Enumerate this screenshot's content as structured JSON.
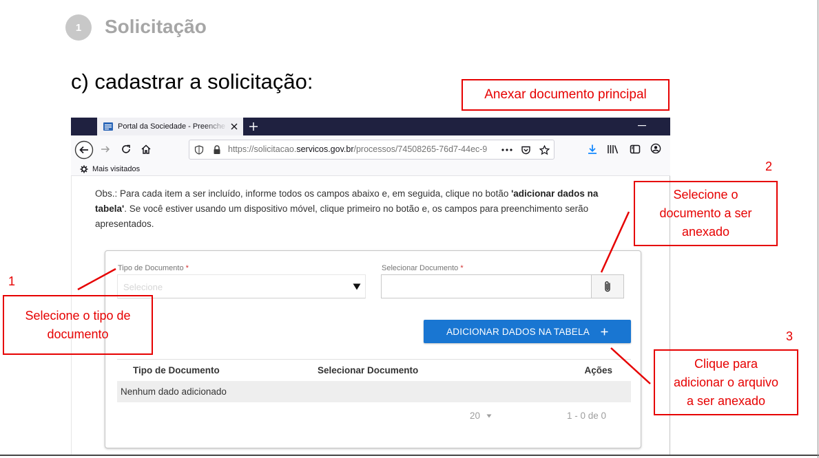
{
  "slide": {
    "step_number": "1",
    "step_title": "Solicitação",
    "heading": "c) cadastrar a solicitação:"
  },
  "annotations": {
    "main_document_label": "Anexar documento principal",
    "marker_1": "1",
    "marker_2": "2",
    "marker_3": "3",
    "callout_1": [
      "Selecione o tipo de",
      "documento"
    ],
    "callout_2": [
      "Selecione o",
      "documento a ser",
      "anexado"
    ],
    "callout_3": [
      "Clique para",
      "adicionar o arquivo",
      "a ser anexado"
    ]
  },
  "browser": {
    "tab_title": "Portal da Sociedade - Preenche",
    "url": {
      "scheme_subdomain": "https://solicitacao.",
      "domain": "servicos.gov.br",
      "path": "/processos/74508265-76d7-44ec-9"
    },
    "bookmarks_folder": "Mais visitados"
  },
  "page": {
    "note": {
      "prefix": "Obs.: Para cada item a ser incluído, informe todos os campos abaixo e, em seguida, clique no botão ",
      "emphasis": "'adicionar dados na tabela'",
      "suffix": ". Se você estiver usando um dispositivo móvel, clique primeiro no botão e, os campos para preenchimento serão apresentados."
    },
    "form": {
      "document_type": {
        "label": "Tipo de Documento",
        "required_mark": "*",
        "placeholder": "Selecione"
      },
      "select_document": {
        "label": "Selecionar Documento",
        "required_mark": "*"
      },
      "add_button_label": "ADICIONAR DADOS NA TABELA"
    },
    "table": {
      "columns": [
        "Tipo de Documento",
        "Selecionar Documento",
        "Ações"
      ],
      "empty_message": "Nenhum dado adicionado"
    },
    "pagination": {
      "page_size": "20",
      "range": "1 - 0 de 0"
    }
  },
  "colors": {
    "annotation": "#e60000",
    "primary_button": "#1976d2",
    "browser_tab_bar": "#1f2140",
    "download_icon": "#0a84ff"
  },
  "icons": [
    "site-favicon-icon",
    "close-tab-icon",
    "new-tab-icon",
    "minimize-window-icon",
    "back-icon",
    "forward-icon",
    "reload-icon",
    "home-icon",
    "shield-icon",
    "lock-icon",
    "more-actions-icon",
    "pocket-icon",
    "star-icon",
    "download-icon",
    "library-icon",
    "sidebar-icon",
    "account-icon",
    "gear-icon",
    "caret-down-icon",
    "paperclip-icon",
    "plus-icon"
  ]
}
